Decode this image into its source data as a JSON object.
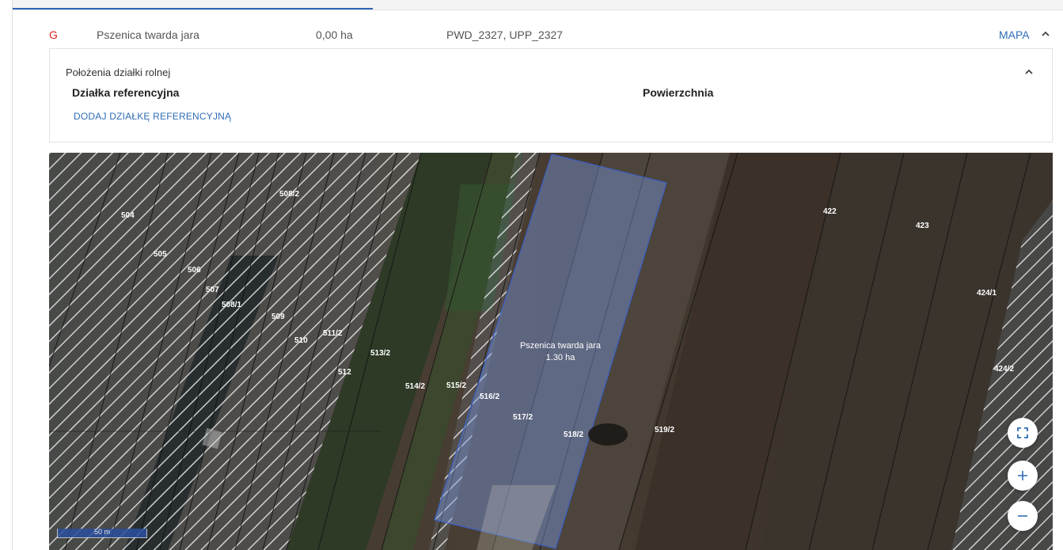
{
  "crop_row": {
    "group": "G",
    "crop": "Pszenica twarda jara",
    "area": "0,00 ha",
    "codes": "PWD_2327, UPP_2327",
    "map_link": "MAPA"
  },
  "location_panel": {
    "title": "Położenia działki rolnej",
    "col_reference": "Działka referencyjna",
    "col_area": "Powierzchnia",
    "add_button": "DODAJ DZIAŁKĘ REFERENCYJNĄ"
  },
  "map": {
    "parcel_labels": [
      "504",
      "505",
      "506",
      "507",
      "508/1",
      "508/2",
      "509",
      "510",
      "511/2",
      "512",
      "513/2",
      "514/2",
      "515/2",
      "516/2",
      "517/2",
      "518/2",
      "519/2",
      "422",
      "423",
      "424/1",
      "424/2"
    ],
    "field_label": {
      "crop": "Pszenica twarda jara",
      "area": "1.30 ha"
    },
    "scale": "50 m",
    "controls": {
      "fullscreen": "fullscreen-icon",
      "zoom_in": "plus-icon",
      "zoom_out": "minus-icon"
    },
    "colors": {
      "field_fill": "#6f8fd6",
      "hatch": "#e8e8e8",
      "accent": "#2f6db5",
      "group": "#e0251b"
    }
  }
}
